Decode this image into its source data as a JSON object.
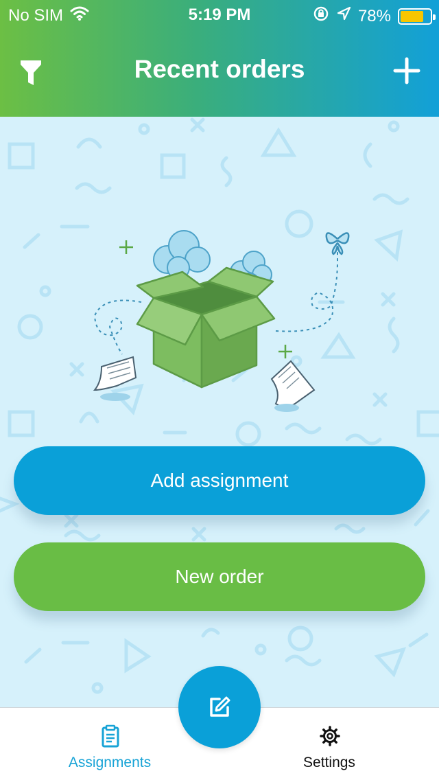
{
  "status_bar": {
    "carrier": "No SIM",
    "time": "5:19 PM",
    "battery_percent": "78%",
    "battery_level": 0.78,
    "icons": [
      "wifi-icon",
      "rotation-lock-icon",
      "location-arrow-icon",
      "battery-icon"
    ]
  },
  "nav": {
    "title": "Recent orders",
    "left_icon": "filter-icon",
    "right_icon": "plus-icon"
  },
  "illustration": {
    "name": "open-box-illustration"
  },
  "actions": {
    "add_assignment": "Add assignment",
    "new_order": "New order"
  },
  "tabs": [
    {
      "label": "Assignments",
      "icon": "clipboard-icon",
      "active": true
    },
    {
      "label": "Settings",
      "icon": "gear-icon",
      "active": false
    }
  ],
  "fab": {
    "icon": "edit-icon"
  },
  "colors": {
    "header_gradient_start": "#6cbf44",
    "header_gradient_end": "#12a0d8",
    "primary_blue": "#0aa0d8",
    "primary_green": "#69bd45",
    "background": "#d6f1fb",
    "active_tab": "#17a3d6"
  }
}
